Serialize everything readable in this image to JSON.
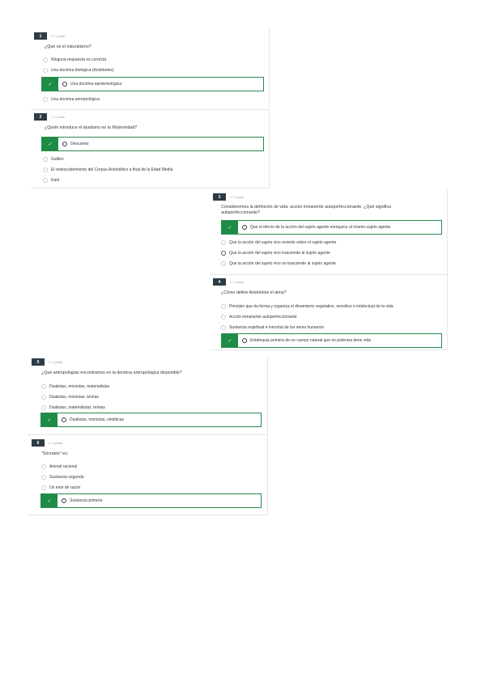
{
  "questions": [
    {
      "number": "1",
      "points": "1 / 1 punto",
      "text": "¿Qué es el naturalismo?",
      "options": [
        "Ninguna respuesta es correcta",
        "Una doctrina biológica (Aristóteles)",
        "Una doctrina epistemológica",
        "Una doctrina antropológica"
      ],
      "correct_index": 2
    },
    {
      "number": "2",
      "points": "1 / 1 punto",
      "text": "¿Quién introduce el dualismo en la Modernidad?",
      "options": [
        "Descartes",
        "Galileo",
        "El redescubrimiento del Corpus Aristotélico a final de la Edad Media",
        "Kant"
      ],
      "correct_index": 0
    },
    {
      "number": "3",
      "points": "1 / 1 punto",
      "text": "Consideremos la definición de vida: acción inmanente autoperfeccionante. ¿Qué significa autoperfeccionante?",
      "options": [
        "Que el efecto de la acción del sujeto agente enriquece al mismo sujeto agente",
        "Que la acción del sujeto vivo revierte sobre el sujeto agente",
        "Que la acción del sujeto vivo trasciende al sujeto agente",
        "Que la acción del sujeto vivo no trasciende al sujeto agente"
      ],
      "correct_index": 0
    },
    {
      "number": "4",
      "points": "1 / 1 punto",
      "text": "¿Cómo define Aristóteles el alma?",
      "options": [
        "Principio que da forma y organiza el dinamismo vegetativo, sensitivo e intelectual de la vida",
        "Acción inmanente autoperfeccionante",
        "Sustancia espiritual e inmortal de los seres humanos",
        "Entelequia primera de un cuerpo natural que en potencia tiene vida"
      ],
      "correct_index": 3
    },
    {
      "number": "5",
      "points": "1 / 1 punto",
      "text": "¿Qué antropologías encontramos en la doctrina antropológica disponible?",
      "options": [
        "Dualistas, monistas, materialistas",
        "Dualistas, monistas, teístas",
        "Dualistas, materialistas, teístas",
        "Dualistas, monistas, sintéticas"
      ],
      "correct_index": 3
    },
    {
      "number": "6",
      "points": "1 / 1 punto",
      "text": "\"Sócrates\" es:",
      "options": [
        "Animal racional",
        "Sustancia segunda",
        "Un ente de razón",
        "Sustancia primera"
      ],
      "correct_index": 3
    }
  ],
  "colors": {
    "correct_green": "#1e8c45",
    "badge_dark": "#2d3b45"
  },
  "icons": {
    "correct_mark": "check-icon"
  }
}
